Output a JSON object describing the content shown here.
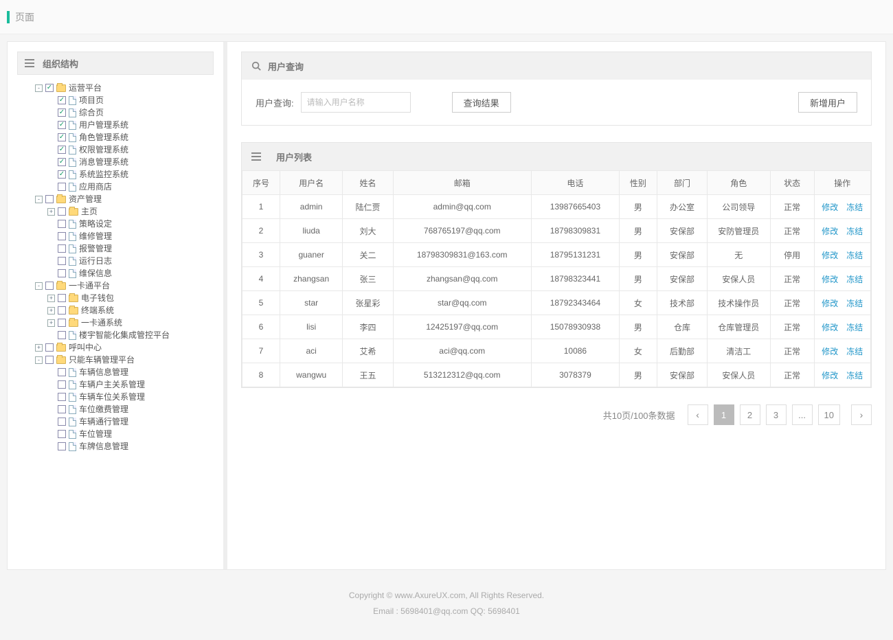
{
  "topbar": {
    "title": "页面"
  },
  "sidebar": {
    "title": "组织结构",
    "tree": [
      {
        "toggle": "-",
        "checked": true,
        "type": "folder",
        "label": "运营平台",
        "children": [
          {
            "toggle": "",
            "checked": true,
            "type": "file",
            "label": "项目页"
          },
          {
            "toggle": "",
            "checked": true,
            "type": "file",
            "label": "综合页"
          },
          {
            "toggle": "",
            "checked": true,
            "type": "file",
            "label": "用户管理系统"
          },
          {
            "toggle": "",
            "checked": true,
            "type": "file",
            "label": "角色管理系统"
          },
          {
            "toggle": "",
            "checked": true,
            "type": "file",
            "label": "权限管理系统"
          },
          {
            "toggle": "",
            "checked": true,
            "type": "file",
            "label": "消息管理系统"
          },
          {
            "toggle": "",
            "checked": true,
            "type": "file",
            "label": "系统监控系统"
          },
          {
            "toggle": "",
            "checked": false,
            "type": "file",
            "label": "应用商店"
          }
        ]
      },
      {
        "toggle": "-",
        "checked": false,
        "type": "folder",
        "label": "资产管理",
        "children": [
          {
            "toggle": "+",
            "checked": false,
            "type": "folder",
            "label": "主页"
          },
          {
            "toggle": "",
            "checked": false,
            "type": "file",
            "label": "策略设定"
          },
          {
            "toggle": "",
            "checked": false,
            "type": "file",
            "label": "维修管理"
          },
          {
            "toggle": "",
            "checked": false,
            "type": "file",
            "label": "报警管理"
          },
          {
            "toggle": "",
            "checked": false,
            "type": "file",
            "label": "运行日志"
          },
          {
            "toggle": "",
            "checked": false,
            "type": "file",
            "label": "维保信息"
          }
        ]
      },
      {
        "toggle": "-",
        "checked": false,
        "type": "folder",
        "label": "一卡通平台",
        "children": [
          {
            "toggle": "+",
            "checked": false,
            "type": "folder",
            "label": "电子钱包"
          },
          {
            "toggle": "+",
            "checked": false,
            "type": "folder",
            "label": "终端系统"
          },
          {
            "toggle": "+",
            "checked": false,
            "type": "folder",
            "label": "一卡通系统"
          },
          {
            "toggle": "",
            "checked": false,
            "type": "file",
            "label": "楼宇智能化集成管控平台"
          }
        ]
      },
      {
        "toggle": "+",
        "checked": false,
        "type": "folder",
        "label": "呼叫中心"
      },
      {
        "toggle": "-",
        "checked": false,
        "type": "folder",
        "label": "只能车辆管理平台",
        "children": [
          {
            "toggle": "",
            "checked": false,
            "type": "file",
            "label": "车辆信息管理"
          },
          {
            "toggle": "",
            "checked": false,
            "type": "file",
            "label": "车辆户主关系管理"
          },
          {
            "toggle": "",
            "checked": false,
            "type": "file",
            "label": "车辆车位关系管理"
          },
          {
            "toggle": "",
            "checked": false,
            "type": "file",
            "label": "车位缴费管理"
          },
          {
            "toggle": "",
            "checked": false,
            "type": "file",
            "label": "车辆通行管理"
          },
          {
            "toggle": "",
            "checked": false,
            "type": "file",
            "label": "车位管理"
          },
          {
            "toggle": "",
            "checked": false,
            "type": "file",
            "label": "车牌信息管理"
          }
        ]
      }
    ]
  },
  "search": {
    "panel_title": "用户查询",
    "label": "用户查询:",
    "placeholder": "请输入用户名称",
    "query_button": "查询结果",
    "add_button": "新增用户"
  },
  "listing": {
    "panel_title": "用户列表",
    "columns": [
      "序号",
      "用户名",
      "姓名",
      "邮箱",
      "电话",
      "性别",
      "部门",
      "角色",
      "状态",
      "操作"
    ],
    "actions": {
      "edit": "修改",
      "freeze": "冻结"
    },
    "rows": [
      {
        "idx": "1",
        "user": "admin",
        "name": "陆仁贾",
        "email": "admin@qq.com",
        "phone": "13987665403",
        "sex": "男",
        "dept": "办公室",
        "role": "公司领导",
        "status": "正常"
      },
      {
        "idx": "2",
        "user": "liuda",
        "name": "刘大",
        "email": "768765197@qq.com",
        "phone": "18798309831",
        "sex": "男",
        "dept": "安保部",
        "role": "安防管理员",
        "status": "正常"
      },
      {
        "idx": "3",
        "user": "guaner",
        "name": "关二",
        "email": "18798309831@163.com",
        "phone": "18795131231",
        "sex": "男",
        "dept": "安保部",
        "role": "无",
        "status": "停用"
      },
      {
        "idx": "4",
        "user": "zhangsan",
        "name": "张三",
        "email": "zhangsan@qq.com",
        "phone": "18798323441",
        "sex": "男",
        "dept": "安保部",
        "role": "安保人员",
        "status": "正常"
      },
      {
        "idx": "5",
        "user": "star",
        "name": "张星彩",
        "email": "star@qq.com",
        "phone": "18792343464",
        "sex": "女",
        "dept": "技术部",
        "role": "技术操作员",
        "status": "正常"
      },
      {
        "idx": "6",
        "user": "lisi",
        "name": "李四",
        "email": "12425197@qq.com",
        "phone": "15078930938",
        "sex": "男",
        "dept": "仓库",
        "role": "仓库管理员",
        "status": "正常"
      },
      {
        "idx": "7",
        "user": "aci",
        "name": "艾希",
        "email": "aci@qq.com",
        "phone": "10086",
        "sex": "女",
        "dept": "后勤部",
        "role": "清洁工",
        "status": "正常"
      },
      {
        "idx": "8",
        "user": "wangwu",
        "name": "王五",
        "email": "513212312@qq.com",
        "phone": "3078379",
        "sex": "男",
        "dept": "安保部",
        "role": "安保人员",
        "status": "正常"
      }
    ]
  },
  "pagination": {
    "info": "共10页/100条数据",
    "prev": "‹",
    "next": "›",
    "pages": [
      "1",
      "2",
      "3",
      "...",
      "10"
    ],
    "active": "1"
  },
  "footer": {
    "line1": "Copyright © www.AxureUX.com, All Rights Reserved.",
    "line2": "Email : 5698401@qq.com  QQ: 5698401"
  }
}
